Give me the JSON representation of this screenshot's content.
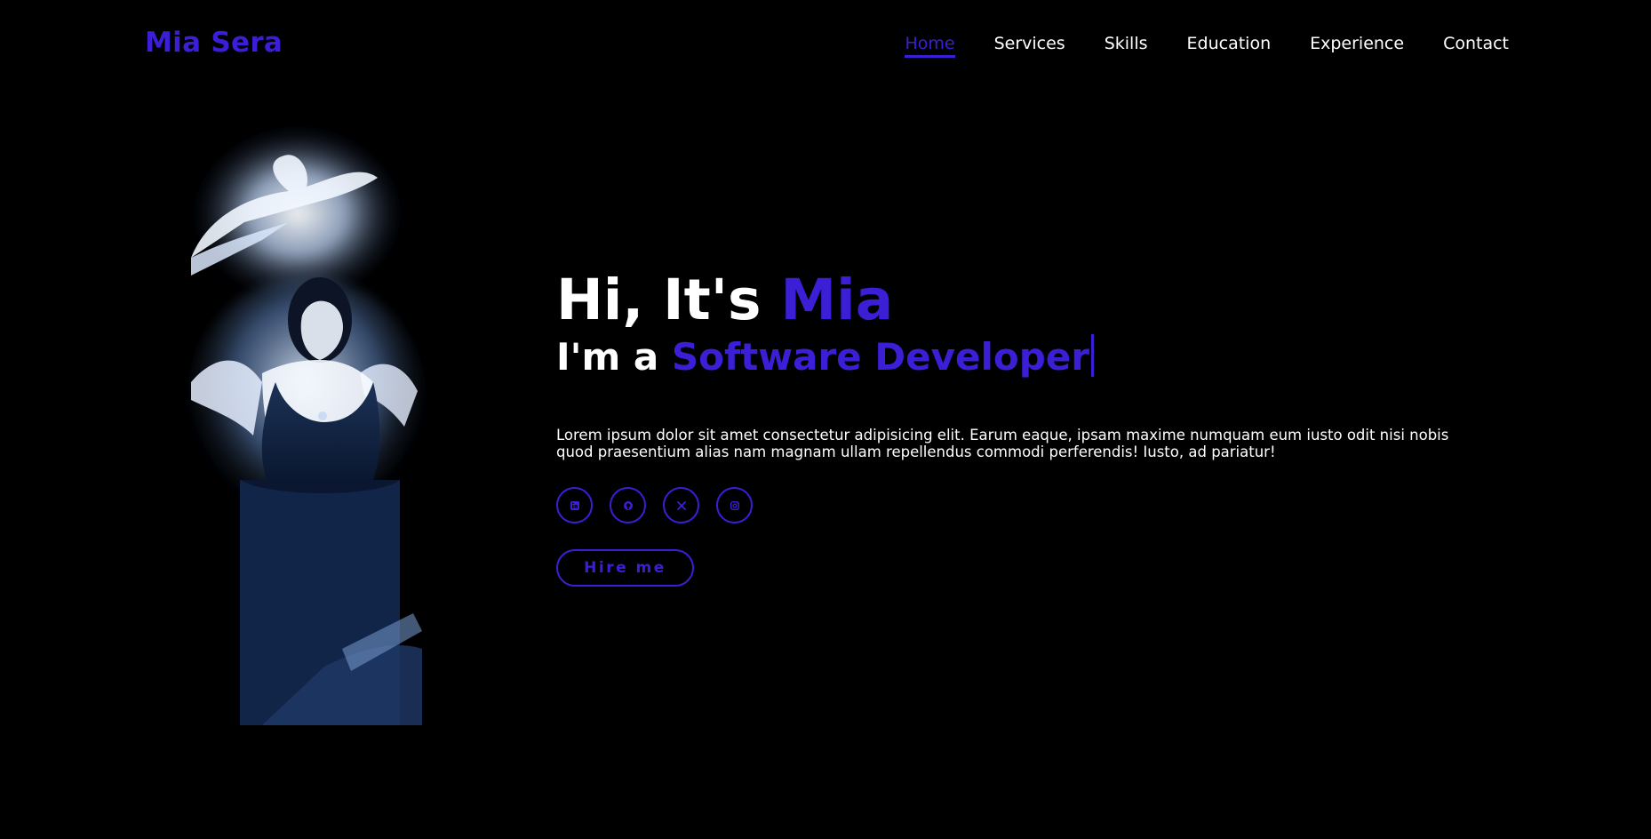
{
  "header": {
    "logo": "Mia Sera",
    "nav": [
      {
        "label": "Home",
        "active": true
      },
      {
        "label": "Services"
      },
      {
        "label": "Skills"
      },
      {
        "label": "Education"
      },
      {
        "label": "Experience"
      },
      {
        "label": "Contact"
      }
    ]
  },
  "hero": {
    "greeting": "Hi, It's ",
    "name": "Mia",
    "role_prefix": "I'm a ",
    "role": "Software Developer",
    "description": "Lorem ipsum dolor sit amet consectetur adipisicing elit. Earum eaque, ipsam maxime numquam eum iusto odit nisi nobis quod praesentium alias nam magnam ullam repellendus commodi perferendis! Iusto, ad pariatur!",
    "socials": [
      {
        "icon": "linkedin-icon"
      },
      {
        "icon": "github-icon"
      },
      {
        "icon": "x-twitter-icon"
      },
      {
        "icon": "instagram-icon"
      }
    ],
    "cta": "Hire me"
  },
  "theme": {
    "accent": "#3a1fd6",
    "background": "#000000",
    "text": "#ffffff"
  }
}
